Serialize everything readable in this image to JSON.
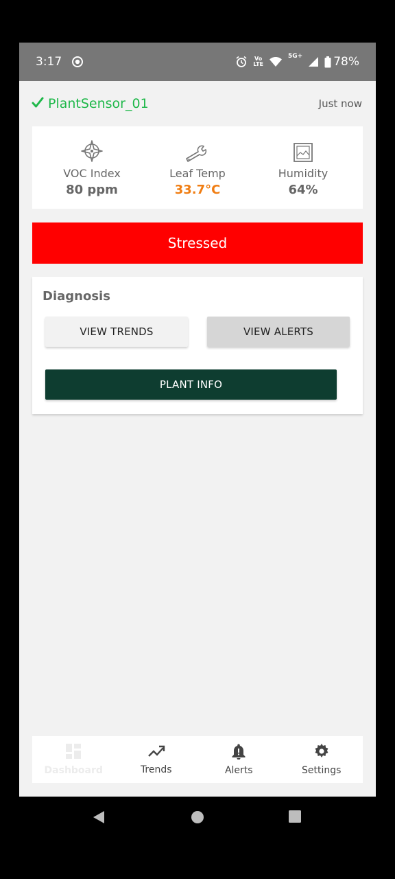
{
  "status_bar": {
    "time": "3:17",
    "network_small": "5G+",
    "volte_line1": "Vo",
    "volte_line2": "LTE",
    "battery": "78%",
    "icons": [
      "record-icon",
      "alarm-icon",
      "volte-icon",
      "wifi-icon",
      "signal-icon",
      "battery-icon"
    ]
  },
  "header": {
    "device_name": "PlantSensor_01",
    "updated": "Just now",
    "check_color": "#1fb84a"
  },
  "metrics": [
    {
      "icon": "compass-icon",
      "label": "VOC Index",
      "value": "80 ppm"
    },
    {
      "icon": "wrench-icon",
      "label": "Leaf Temp",
      "value": "33.7°C",
      "value_color": "#f07d12"
    },
    {
      "icon": "image-icon",
      "label": "Humidity",
      "value": "64%"
    }
  ],
  "status_banner": {
    "label": "Stressed",
    "color": "#ff0000"
  },
  "diagnosis": {
    "title": "Diagnosis",
    "view_trends_label": "VIEW TRENDS",
    "view_alerts_label": "VIEW ALERTS",
    "plant_info_label": "PLANT INFO",
    "plant_info_color": "#0e3d30"
  },
  "bottom_nav": [
    {
      "icon": "dashboard-icon",
      "label": "Dashboard",
      "active": true
    },
    {
      "icon": "trending-up-icon",
      "label": "Trends"
    },
    {
      "icon": "bell-alert-icon",
      "label": "Alerts"
    },
    {
      "icon": "gear-icon",
      "label": "Settings"
    }
  ],
  "system_nav": [
    "back-icon",
    "home-icon",
    "recents-icon"
  ]
}
